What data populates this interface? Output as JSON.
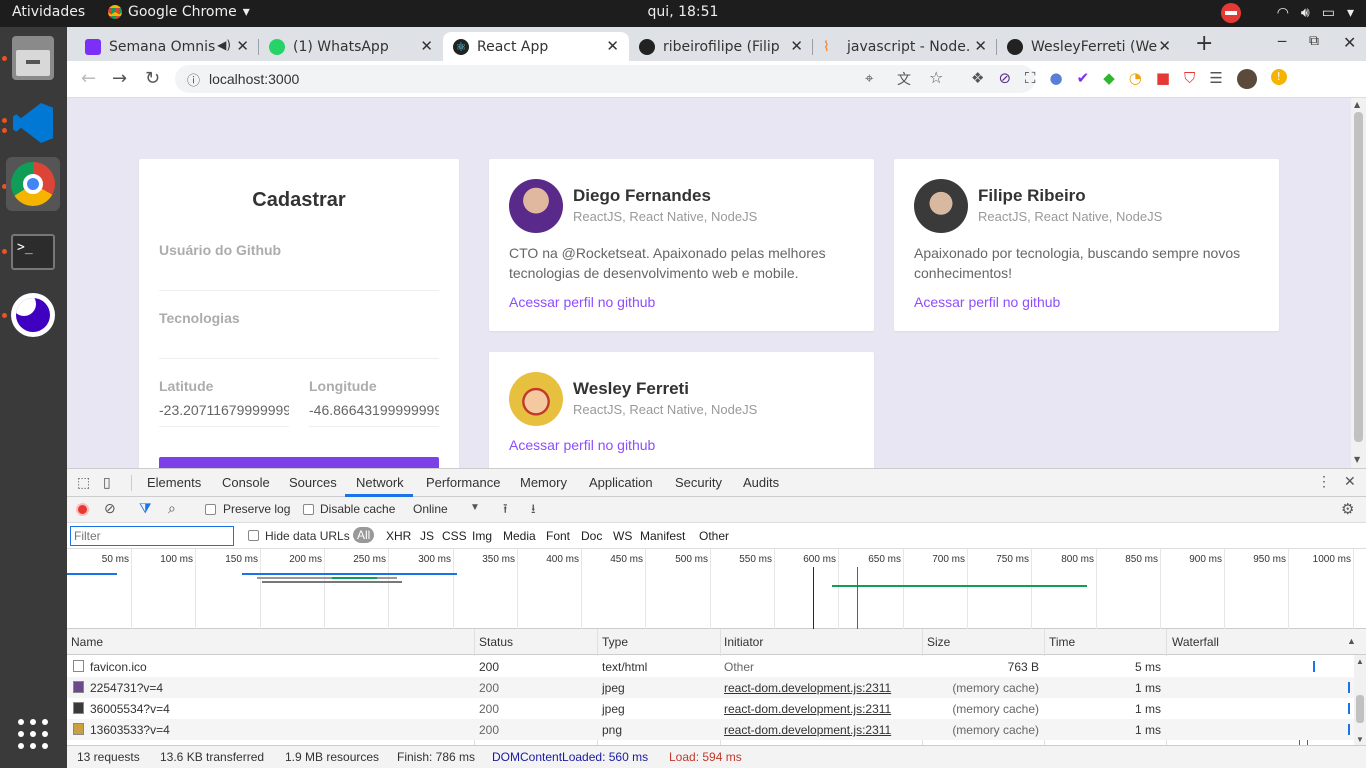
{
  "topbar": {
    "activities": "Atividades",
    "app_name": "Google Chrome",
    "clock": "qui, 18:51"
  },
  "tabs": [
    {
      "title": "Semana Omnis",
      "color": "#7b2ff7"
    },
    {
      "title": "(1) WhatsApp",
      "color": "#25d366"
    },
    {
      "title": "React App",
      "color": "#222222"
    },
    {
      "title": "ribeirofilipe (Filip",
      "color": "#222222"
    },
    {
      "title": "javascript - Node.",
      "color": "#f48024"
    },
    {
      "title": "WesleyFerreti (We",
      "color": "#222222"
    }
  ],
  "omnibox": {
    "url": "localhost:3000"
  },
  "form": {
    "title": "Cadastrar",
    "github_label": "Usuário do Github",
    "techs_label": "Tecnologias",
    "lat_label": "Latitude",
    "lat_value": "-23.20711679999999",
    "lon_label": "Longitude",
    "lon_value": "-46.86643199999999"
  },
  "devs": [
    {
      "name": "Diego Fernandes",
      "techs": "ReactJS, React Native, NodeJS",
      "bio_1": "CTO na @Rocketseat. Apaixonado pelas melhores",
      "bio_2": "tecnologias de desenvolvimento web e mobile.",
      "link": "Acessar perfil no github"
    },
    {
      "name": "Filipe Ribeiro",
      "techs": "ReactJS, React Native, NodeJS",
      "bio_1": "Apaixonado por tecnologia, buscando sempre novos",
      "bio_2": "conhecimentos!",
      "link": "Acessar perfil no github"
    },
    {
      "name": "Wesley Ferreti",
      "techs": "ReactJS, React Native, NodeJS",
      "link": "Acessar perfil no github"
    }
  ],
  "devtools": {
    "tabs": [
      "Elements",
      "Console",
      "Sources",
      "Network",
      "Performance",
      "Memory",
      "Application",
      "Security",
      "Audits"
    ],
    "active_tab": "Network",
    "preserve_log": "Preserve log",
    "disable_cache": "Disable cache",
    "throttle": "Online",
    "filter_placeholder": "Filter",
    "hide_data_urls": "Hide data URLs",
    "types": [
      "All",
      "XHR",
      "JS",
      "CSS",
      "Img",
      "Media",
      "Font",
      "Doc",
      "WS",
      "Manifest",
      "Other"
    ],
    "ticks": [
      "50 ms",
      "100 ms",
      "150 ms",
      "200 ms",
      "250 ms",
      "300 ms",
      "350 ms",
      "400 ms",
      "450 ms",
      "500 ms",
      "550 ms",
      "600 ms",
      "650 ms",
      "700 ms",
      "750 ms",
      "800 ms",
      "850 ms",
      "900 ms",
      "950 ms",
      "1000 ms"
    ],
    "columns": [
      "Name",
      "Status",
      "Type",
      "Initiator",
      "Size",
      "Time",
      "Waterfall"
    ],
    "rows": [
      {
        "name": "favicon.ico",
        "status": "200",
        "type": "text/html",
        "initiator": "Other",
        "size": "763 B",
        "time": "5 ms"
      },
      {
        "name": "2254731?v=4",
        "status": "200",
        "type": "jpeg",
        "initiator": "react-dom.development.js:2311",
        "size": "(memory cache)",
        "time": "1 ms"
      },
      {
        "name": "36005534?v=4",
        "status": "200",
        "type": "jpeg",
        "initiator": "react-dom.development.js:2311",
        "size": "(memory cache)",
        "time": "1 ms"
      },
      {
        "name": "13603533?v=4",
        "status": "200",
        "type": "png",
        "initiator": "react-dom.development.js:2311",
        "size": "(memory cache)",
        "time": "1 ms"
      }
    ],
    "footer": {
      "requests": "13 requests",
      "transferred": "13.6 KB transferred",
      "resources": "1.9 MB resources",
      "finish": "Finish: 786 ms",
      "dcl": "DOMContentLoaded: 560 ms",
      "load": "Load: 594 ms"
    }
  }
}
